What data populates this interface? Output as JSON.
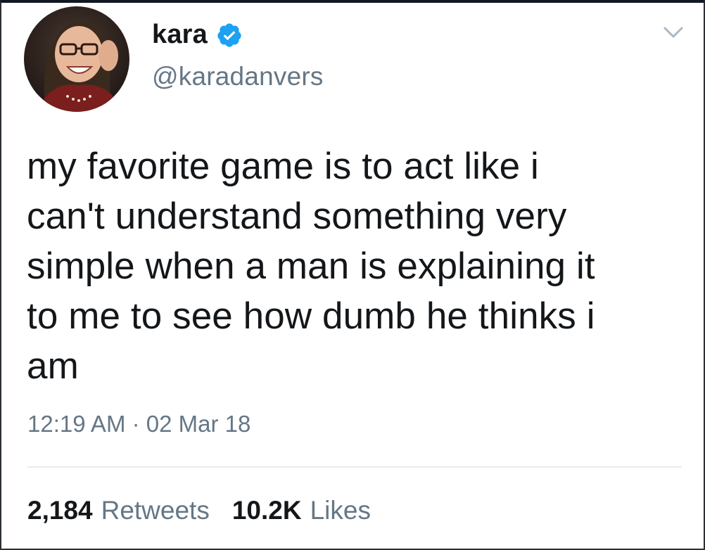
{
  "user": {
    "display_name": "kara",
    "handle": "@karadanvers",
    "verified": true,
    "verified_color": "#1da1f2",
    "avatar_icon": "profile-photo"
  },
  "tweet": {
    "text": "my favorite game is to act like i\ncan't understand something very\nsimple when a man is explaining it\nto me to see how dumb he thinks i\nam",
    "time": "12:19 AM",
    "separator": " · ",
    "date": "02 Mar 18"
  },
  "stats": {
    "retweets_count": "2,184",
    "retweets_label": "Retweets",
    "likes_count": "10.2K",
    "likes_label": "Likes"
  },
  "menu": {
    "caret_icon": "chevron-down-icon"
  }
}
